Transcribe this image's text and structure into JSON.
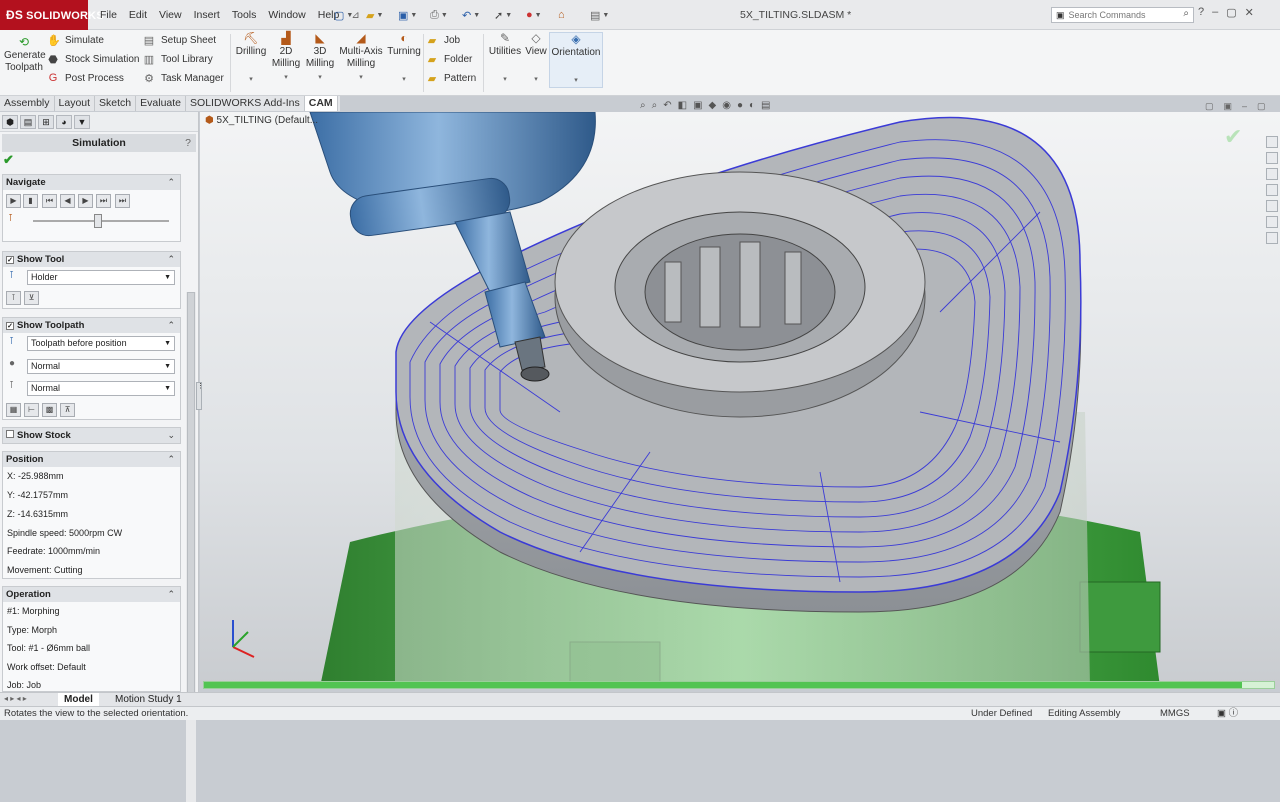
{
  "app": {
    "brand": "SOLIDWORKS",
    "document_title": "5X_TILTING.SLDASM *"
  },
  "menu": [
    "File",
    "Edit",
    "View",
    "Insert",
    "Tools",
    "Window",
    "Help"
  ],
  "search": {
    "placeholder": "Search Commands"
  },
  "ribbon": {
    "generate_toolpath": "Generate Toolpath",
    "simulate": "Simulate",
    "stock_simulation": "Stock Simulation",
    "post_process": "Post Process",
    "setup_sheet": "Setup Sheet",
    "tool_library": "Tool Library",
    "task_manager": "Task Manager",
    "drilling": "Drilling",
    "milling_2d": "2D Milling",
    "milling_3d": "3D Milling",
    "multi_axis_milling": "Multi-Axis Milling",
    "turning": "Turning",
    "job": "Job",
    "folder": "Folder",
    "pattern": "Pattern",
    "utilities": "Utilities",
    "view": "View",
    "orientation": "Orientation"
  },
  "tabs": [
    "Assembly",
    "Layout",
    "Sketch",
    "Evaluate",
    "SOLIDWORKS Add-Ins",
    "CAM"
  ],
  "active_tab": "CAM",
  "tree_label": "5X_TILTING  (Default...",
  "panel": {
    "title": "Simulation",
    "help": "?",
    "navigate": {
      "header": "Navigate"
    },
    "show_tool": {
      "header": "Show Tool",
      "select_value": "Holder"
    },
    "show_toolpath": {
      "header": "Show Toolpath",
      "select1": "Toolpath before position",
      "select2": "Normal",
      "select3": "Normal"
    },
    "show_stock": {
      "header": "Show Stock"
    },
    "position": {
      "header": "Position",
      "x": "X: -25.988mm",
      "y": "Y: -42.1757mm",
      "z": "Z: -14.6315mm",
      "spindle": "Spindle speed: 5000rpm CW",
      "feedrate": "Feedrate: 1000mm/min",
      "movement": "Movement: Cutting"
    },
    "operation": {
      "header": "Operation",
      "name": "#1: Morphing",
      "type": "Type: Morph",
      "tool": "Tool: #1 - Ø6mm ball",
      "work_offset": "Work offset: Default",
      "job": "Job: Job"
    }
  },
  "slider": {
    "position": 0.48
  },
  "progress": {
    "fraction": 0.97
  },
  "bottom_tabs": [
    "Model",
    "Motion Study 1"
  ],
  "status": {
    "message": "Rotates the view to the selected orientation.",
    "definition": "Under Defined",
    "mode": "Editing Assembly",
    "units": "MMGS"
  },
  "colors": {
    "brand": "#b3111e",
    "toolpath": "#3b3bd6",
    "fixture": "#3e9a3e",
    "progress": "#52c452"
  }
}
